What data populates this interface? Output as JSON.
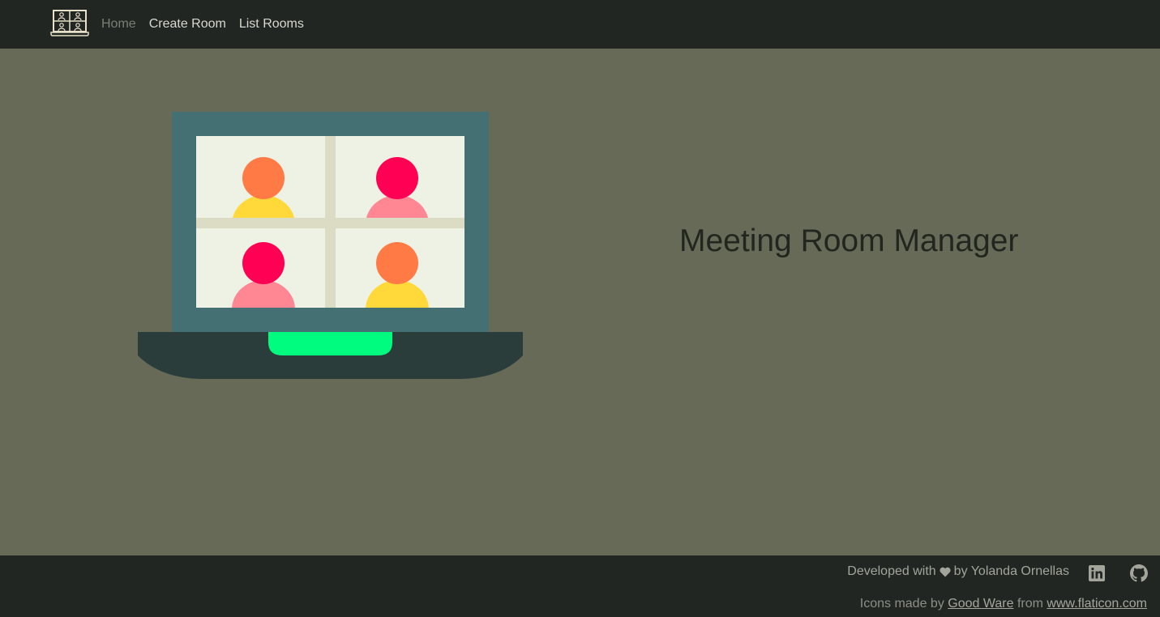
{
  "nav": {
    "brand_icon": "video-conference-logo-icon",
    "items": [
      {
        "label": "Home",
        "active": true
      },
      {
        "label": "Create Room",
        "active": false
      },
      {
        "label": "List Rooms",
        "active": false
      }
    ]
  },
  "hero": {
    "title": "Meeting Room Manager",
    "illustration": "video-call-laptop-illustration"
  },
  "footer": {
    "developed_prefix": "Developed with",
    "developed_suffix": "by Yolanda Ornellas",
    "heart_icon": "heart-icon",
    "linkedin_icon": "linkedin-icon",
    "github_icon": "github-icon",
    "attribution_prefix": "Icons made by",
    "attribution_author": "Good Ware",
    "attribution_middle": "from",
    "attribution_site": "www.flaticon.com"
  },
  "colors": {
    "navbar_bg": "#212623",
    "page_bg": "#666a57",
    "title_color": "#22261f",
    "laptop_frame": "#446f73",
    "laptop_base": "#2b3d3b",
    "trackpad": "#00fc7f",
    "screen_bg": "#eef2e4",
    "divider": "#dcdcc4",
    "avatar_orange": "#ff7a45",
    "avatar_yellow": "#ffd93a",
    "avatar_red": "#ff0055",
    "avatar_pink": "#ff8794"
  }
}
